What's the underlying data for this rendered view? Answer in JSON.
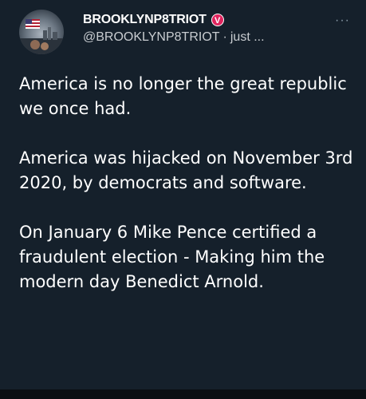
{
  "author": {
    "display_name": "BROOKLYNP8TRIOT",
    "badge_letter": "V",
    "badge_color": "#e0245e",
    "handle": "@BROOKLYNP8TRIOT",
    "separator": "·",
    "timestamp": "just ..."
  },
  "more_icon": "more-horizontal-icon",
  "more_label": "···",
  "tweet": {
    "paragraphs": [
      "America is no longer the great republic we once had.",
      "America was hijacked on November 3rd 2020, by democrats and software.",
      "On January 6 Mike Pence certified a fraudulent election - Making him the modern day Benedict Arnold."
    ]
  },
  "colors": {
    "background": "#15202b",
    "text": "#ffffff",
    "secondary_text": "#c8ccd0"
  }
}
